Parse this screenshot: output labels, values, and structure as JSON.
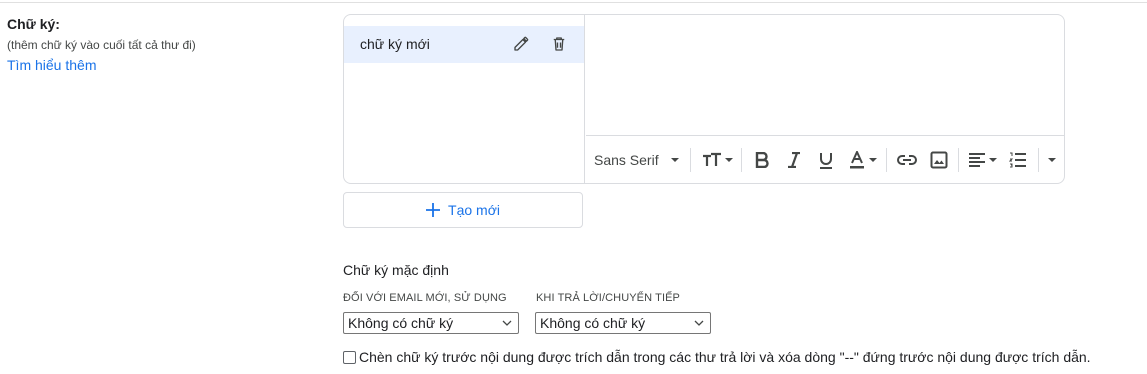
{
  "section": {
    "title": "Chữ ký:",
    "description": "(thêm chữ ký vào cuối tất cả thư đi)",
    "learn_more": "Tìm hiểu thêm"
  },
  "signatures": [
    {
      "name": "chữ ký mới"
    }
  ],
  "toolbar": {
    "font": "Sans Serif",
    "icons": [
      "font-size-icon",
      "bold-icon",
      "italic-icon",
      "underline-icon",
      "text-color-icon",
      "link-icon",
      "image-icon",
      "align-icon",
      "numbered-list-icon",
      "more-options-icon"
    ]
  },
  "new_button": {
    "label": "Tạo mới"
  },
  "defaults": {
    "title": "Chữ ký mặc định",
    "new_email_label": "ĐỐI VỚI EMAIL MỚI, SỬ DỤNG",
    "new_email_value": "Không có chữ ký",
    "reply_label": "KHI TRẢ LỜI/CHUYỂN TIẾP",
    "reply_value": "Không có chữ ký"
  },
  "insert_before_quote": {
    "checked": false,
    "label": "Chèn chữ ký trước nội dung được trích dẫn trong các thư trả lời và xóa dòng \"--\" đứng trước nội dung được trích dẫn."
  },
  "colors": {
    "accent": "#1a73e8",
    "selected_bg": "#e8f0fe",
    "border": "#dadce0"
  }
}
